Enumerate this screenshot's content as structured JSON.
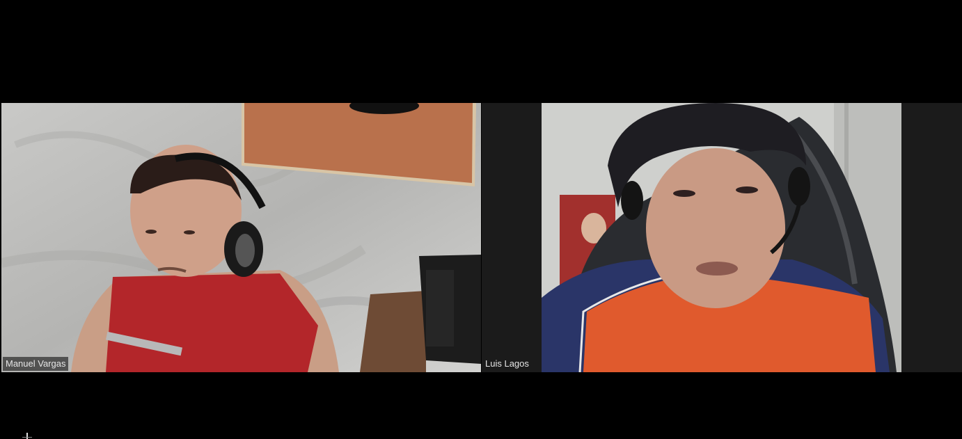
{
  "meeting": {
    "participants": [
      {
        "name": "Manuel Vargas",
        "video": "webcam-feed"
      },
      {
        "name": "Luis Lagos",
        "video": "webcam-feed"
      }
    ]
  },
  "colors": {
    "background": "#000000",
    "tile_background": "#1b1b1b",
    "name_tag_text": "#e6e6e6"
  }
}
